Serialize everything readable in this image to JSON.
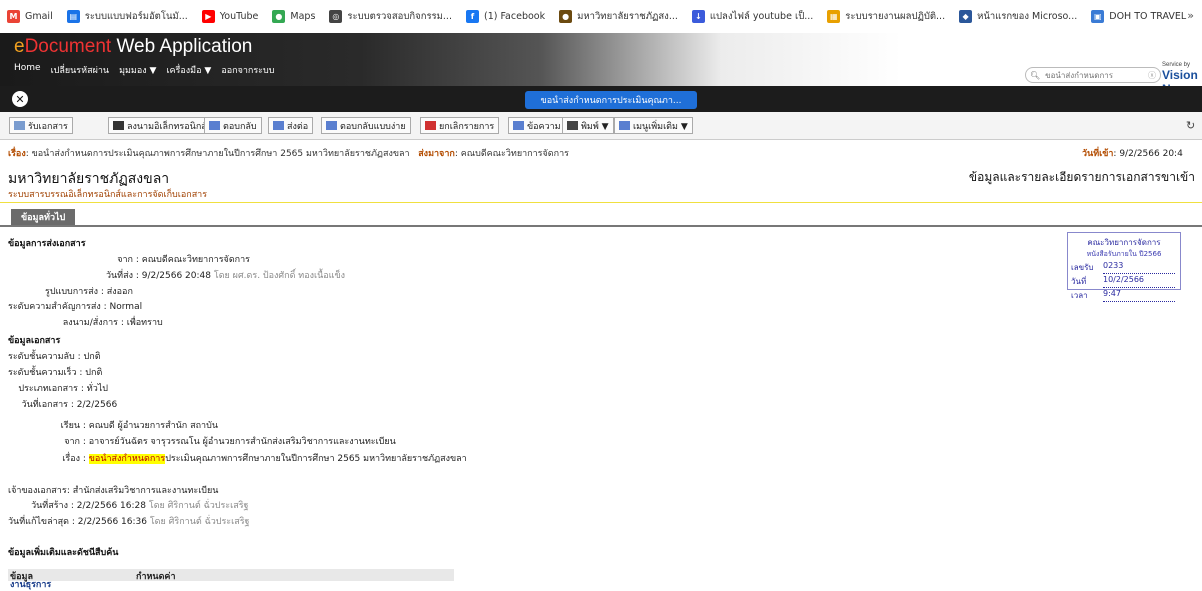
{
  "bookmarks": [
    {
      "label": "Gmail",
      "color": "#ea4335",
      "glyph": "M"
    },
    {
      "label": "ระบบแบบฟอร์มอัตโนมั...",
      "color": "#1a73e8",
      "glyph": "▤"
    },
    {
      "label": "YouTube",
      "color": "#ff0000",
      "glyph": "▶"
    },
    {
      "label": "Maps",
      "color": "#34a853",
      "glyph": "●"
    },
    {
      "label": "ระบบตรวจสอบกิจกรรม...",
      "color": "#444444",
      "glyph": "◎"
    },
    {
      "label": "(1) Facebook",
      "color": "#1877f2",
      "glyph": "f"
    },
    {
      "label": "มหาวิทยาลัยราชภัฏสง...",
      "color": "#6b4a10",
      "glyph": "●"
    },
    {
      "label": "แปลงไฟล์ youtube เป็...",
      "color": "#3b5bdb",
      "glyph": "↓"
    },
    {
      "label": "ระบบรายงานผลปฏิบัติ...",
      "color": "#e8a000",
      "glyph": "▦"
    },
    {
      "label": "หน้าแรกของ Microso...",
      "color": "#2b579a",
      "glyph": "◆"
    },
    {
      "label": "DOH TO TRAVEL",
      "color": "#3a7bd5",
      "glyph": "▣"
    }
  ],
  "bookmarks_more": "»",
  "app": {
    "logo_e": "e",
    "logo_doc": "Document",
    "logo_rest": " Web Application",
    "menu": [
      "Home",
      "เปลี่ยนรหัสผ่าน",
      "มุมมอง ▼",
      "เครื่องมือ ▼",
      "ออกจากระบบ"
    ],
    "search_placeholder": "ขอนำส่งกำหนดการ",
    "vision_small": "Service by",
    "vision_big": "Vision Ne"
  },
  "title_tab": "ขอนำส่งกำหนดการประเมินคุณภา...",
  "toolbar": [
    {
      "label": "รับเอกสาร",
      "icon_color": "#7a9ccf"
    },
    {
      "label": "ลงนามอิเล็กทรอนิกส์",
      "icon_color": "#333333"
    },
    {
      "label": "ตอบกลับ",
      "icon_color": "#5a7fd0"
    },
    {
      "label": "ส่งต่อ",
      "icon_color": "#5a7fd0"
    },
    {
      "label": "ตอบกลับแบบง่าย",
      "icon_color": "#5a7fd0"
    },
    {
      "label": "ยกเลิกรายการ",
      "icon_color": "#d03030"
    },
    {
      "label": "ข้อความ",
      "icon_color": "#5a7fd0"
    },
    {
      "label": "พิมพ์ ▼",
      "icon_color": "#444444"
    },
    {
      "label": "เมนูเพิ่มเติม ▼",
      "icon_color": "#5a7fd0"
    }
  ],
  "refresh_glyph": "↻",
  "subject": {
    "label": "เรื่อง",
    "text": ": ขอนำส่งกำหนดการประเมินคุณภาพการศึกษาภายในปีการศึกษา 2565 มหาวิทยาลัยราชภัฏสงขลา",
    "from_label": "ส่งมาจาก",
    "from_text": ": คณบดีคณะวิทยาการจัดการ",
    "recv_label": "วันที่เข้า",
    "recv_text": ": 9/2/2566 20:4"
  },
  "org": {
    "name": "มหาวิทยาลัยราชภัฏสงขลา",
    "sub": "ระบบสารบรรณอิเล็กทรอนิกส์และการจัดเก็บเอกสาร",
    "detail_heading": "ข้อมูลและรายละเอียดรายการเอกสารขาเข้า"
  },
  "tab_general": "ข้อมูลทั่วไป",
  "send_section": {
    "title": "ข้อมูลการส่งเอกสาร",
    "from_k": "จาก",
    "from_v": "คณบดีคณะวิทยาการจัดการ",
    "date_k": "วันที่ส่ง",
    "date_v": "9/2/2566 20:48",
    "date_by": "โดย ผศ.ดร. ป้องศักดิ์ ทองเนื้อแข็ง",
    "format_k": "รูปแบบการส่ง",
    "format_v": "ส่งออก",
    "priority_k": "ระดับความสำคัญการส่ง",
    "priority_v": "Normal",
    "order_k": "ลงนาม/สั่งการ",
    "order_v": "เพื่อทราบ"
  },
  "doc_section": {
    "title": "ข้อมูลเอกสาร",
    "secret_k": "ระดับชั้นความลับ",
    "secret_v": "ปกติ",
    "speed_k": "ระดับชั้นความเร็ว",
    "speed_v": "ปกติ",
    "type_k": "ประเภทเอกสาร",
    "type_v": "ทั่วไป",
    "docdate_k": "วันที่เอกสาร",
    "docdate_v": "2/2/2566",
    "to_k": "เรียน",
    "to_v": "คณบดี ผู้อำนวยการสำนัก สถาบัน",
    "from_k": "จาก",
    "from_v": "อาจารย์วันฉัตร จารุวรรณโน ผู้อำนวยการสำนักส่งเสริมวิชาการและงานทะเบียน",
    "subj_k": "เรื่อง",
    "subj_hl": "ขอนำส่งกำหนดการ",
    "subj_rest": "ประเมินคุณภาพการศึกษาภายในปีการศึกษา 2565 มหาวิทยาลัยราชภัฏสงขลา",
    "owner_k": "เจ้าของเอกสาร",
    "owner_v": "สำนักส่งเสริมวิชาการและงานทะเบียน",
    "created_k": "วันที่สร้าง",
    "created_v": "2/2/2566 16:28",
    "created_by": "โดย ศิริกานต์ ฉั่วประเสริฐ",
    "modified_k": "วันที่แก้ไขล่าสุด",
    "modified_v": "2/2/2566 16:36",
    "modified_by": "โดย ศิริกานต์ ฉั่วประเสริฐ"
  },
  "stamp": {
    "org": "คณะวิทยาการจัดการ",
    "sub": "หนังสือรับภายใน ปี2566",
    "num_k": "เลขรับ",
    "num_v": "0233",
    "date_k": "วันที่",
    "date_v": "10/2/2566",
    "time_k": "เวลา",
    "time_v": "9:47"
  },
  "extra_section": {
    "title": "ข้อมูลเพิ่มเติมและดัชนีสืบค้น",
    "col1": "ข้อมูล",
    "col2": "กำหนดค่า",
    "row1": "งานธุรการ"
  }
}
